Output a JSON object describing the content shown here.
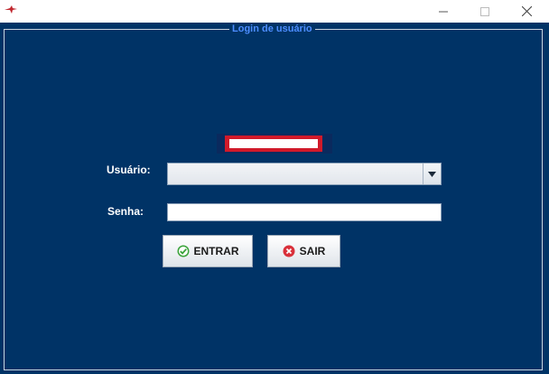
{
  "window": {
    "title": "",
    "controls": [
      "minimize",
      "maximize",
      "close"
    ]
  },
  "login_panel": {
    "group_title": "Login de usuário",
    "error_message": "",
    "user_label": "Usuário:",
    "user_selected": "",
    "password_label": "Senha:",
    "password_value": "",
    "enter_button": "ENTRAR",
    "exit_button": "SAIR"
  },
  "icons": {
    "app": "red-bird-logo-icon",
    "enter": "green-check-icon",
    "exit": "red-x-icon",
    "combo": "chevron-down-icon"
  },
  "colors": {
    "panel_background": "#003366",
    "title_accent": "#4d8dff",
    "error_red": "#d11a2a",
    "enter_green": "#3aa33a",
    "exit_red": "#d9303a"
  }
}
